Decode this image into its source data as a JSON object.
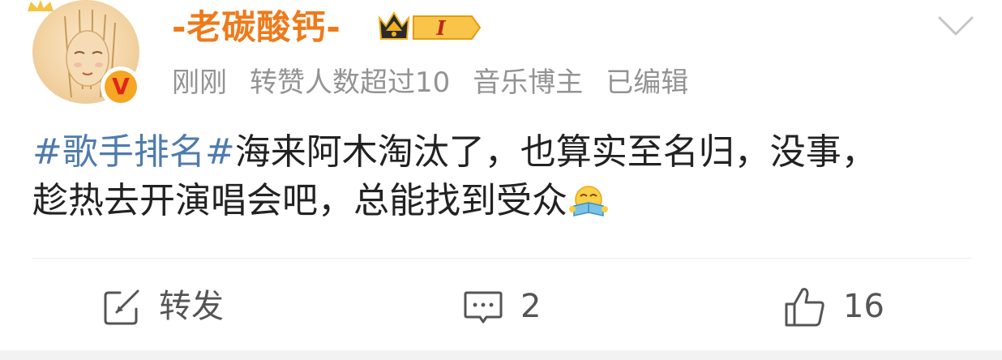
{
  "post": {
    "author": {
      "name": "-老碳酸钙-",
      "vip_level": "I",
      "verified": true,
      "verify_mark": "V"
    },
    "meta": {
      "time": "刚刚",
      "reposts_note": "转赞人数超过10",
      "tag": "音乐博主",
      "edited": "已编辑"
    },
    "content": {
      "topic": "#歌手排名#",
      "line1_rest": "海来阿木淘汰了，也算实至名归，没事，",
      "line2": "趁热去开演唱会吧，总能找到受众",
      "emoji": "reading-laugh-emoji"
    },
    "actions": {
      "repost_label": "转发",
      "comment_count": "2",
      "like_count": "16"
    }
  },
  "colors": {
    "username": "#ee7a1a",
    "topic": "#4f7cae",
    "meta": "#939393",
    "text": "#222222",
    "action": "#555555"
  }
}
